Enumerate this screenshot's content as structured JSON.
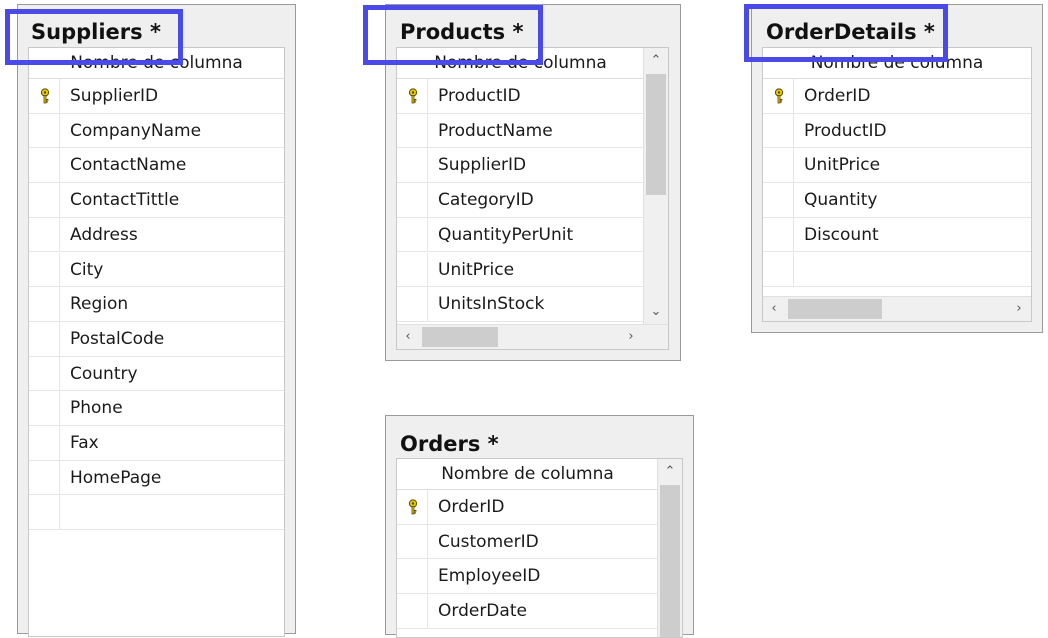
{
  "column_header": "Nombre de columna",
  "accent_color": "#4a4ae8",
  "key_icon_color": "#e8c800",
  "tables": {
    "suppliers": {
      "title": "Suppliers *",
      "columns": [
        "SupplierID",
        "CompanyName",
        "ContactName",
        "ContactTittle",
        "Address",
        "City",
        "Region",
        "PostalCode",
        "Country",
        "Phone",
        "Fax",
        "HomePage"
      ]
    },
    "products": {
      "title": "Products *",
      "columns": [
        "ProductID",
        "ProductName",
        "SupplierID",
        "CategoryID",
        "QuantityPerUnit",
        "UnitPrice",
        "UnitsInStock"
      ]
    },
    "orderdetails": {
      "title": "OrderDetails *",
      "columns": [
        "OrderID",
        "ProductID",
        "UnitPrice",
        "Quantity",
        "Discount"
      ]
    },
    "orders": {
      "title": "Orders *",
      "columns": [
        "OrderID",
        "CustomerID",
        "EmployeeID",
        "OrderDate"
      ]
    }
  },
  "icons": {
    "primary_key": "key-icon",
    "scroll_up": "chevron-up-icon",
    "scroll_down": "chevron-down-icon",
    "scroll_left": "chevron-left-icon",
    "scroll_right": "chevron-right-icon"
  }
}
